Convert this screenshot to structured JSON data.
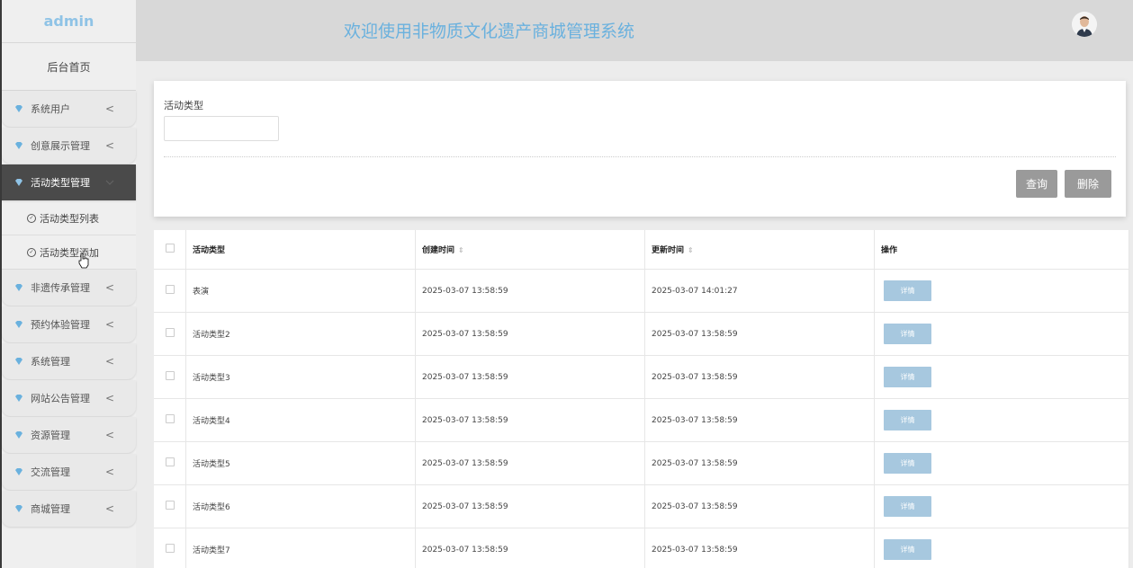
{
  "sidebar": {
    "brand": "admin",
    "home": "后台首页",
    "items": [
      {
        "label": "系统用户"
      },
      {
        "label": "创意展示管理"
      },
      {
        "label": "活动类型管理"
      },
      {
        "label": "非遗传承管理"
      },
      {
        "label": "预约体验管理"
      },
      {
        "label": "系统管理"
      },
      {
        "label": "网站公告管理"
      },
      {
        "label": "资源管理"
      },
      {
        "label": "交流管理"
      },
      {
        "label": "商城管理"
      }
    ],
    "submenu": [
      "活动类型列表",
      "活动类型添加"
    ],
    "chevron": "<"
  },
  "header": {
    "title": "欢迎使用非物质文化遗产商城管理系统"
  },
  "search": {
    "label": "活动类型",
    "value": "",
    "query_label": "查询",
    "delete_label": "删除"
  },
  "table": {
    "headers": {
      "type": "活动类型",
      "created": "创建时间",
      "updated": "更新时间",
      "action": "操作"
    },
    "rows": [
      {
        "type": "表演",
        "created": "2025-03-07 13:58:59",
        "updated": "2025-03-07 14:01:27",
        "action": "详情"
      },
      {
        "type": "活动类型2",
        "created": "2025-03-07 13:58:59",
        "updated": "2025-03-07 13:58:59",
        "action": "详情"
      },
      {
        "type": "活动类型3",
        "created": "2025-03-07 13:58:59",
        "updated": "2025-03-07 13:58:59",
        "action": "详情"
      },
      {
        "type": "活动类型4",
        "created": "2025-03-07 13:58:59",
        "updated": "2025-03-07 13:58:59",
        "action": "详情"
      },
      {
        "type": "活动类型5",
        "created": "2025-03-07 13:58:59",
        "updated": "2025-03-07 13:58:59",
        "action": "详情"
      },
      {
        "type": "活动类型6",
        "created": "2025-03-07 13:58:59",
        "updated": "2025-03-07 13:58:59",
        "action": "详情"
      },
      {
        "type": "活动类型7",
        "created": "2025-03-07 13:58:59",
        "updated": "2025-03-07 13:58:59",
        "action": "详情"
      }
    ]
  },
  "colors": {
    "accent": "#6ab1de",
    "sidebar_active": "#4a4a4a",
    "button_gray": "#9a9a9a",
    "detail_button": "#a7c8df"
  }
}
